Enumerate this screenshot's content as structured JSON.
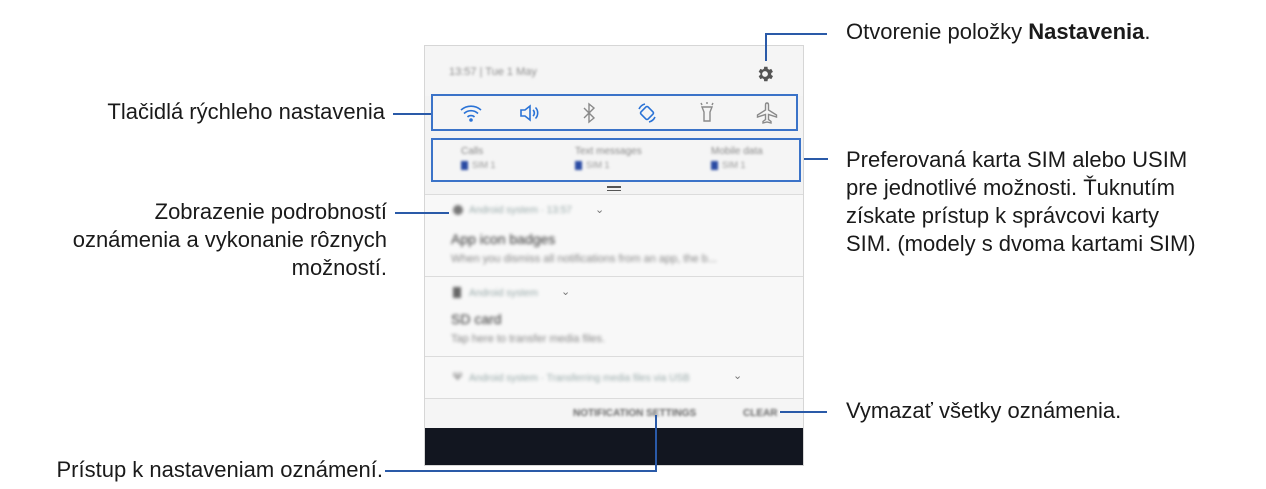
{
  "phone": {
    "status_time": "13:57 | Tue 1 May",
    "sim": [
      {
        "title": "Calls",
        "value": "SIM 1"
      },
      {
        "title": "Text messages",
        "value": "SIM 1"
      },
      {
        "title": "Mobile data",
        "value": "SIM 1"
      }
    ],
    "notifications": [
      {
        "source": "Android system · 13:57",
        "title": "App icon badges",
        "body": "When you dismiss all notifications from an app, the b..."
      },
      {
        "source": "Android system",
        "title": "SD card",
        "body": "Tap here to transfer media files."
      },
      {
        "source": "Android system · Transferring media files via USB"
      }
    ],
    "actions": {
      "settings": "NOTIFICATION SETTINGS",
      "clear": "CLEAR"
    }
  },
  "callouts": {
    "settings_prefix": "Otvorenie položky ",
    "settings_bold": "Nastavenia",
    "settings_suffix": ".",
    "quick": "Tlačidlá rýchleho nastavenia",
    "sim_lines": [
      "Preferovaná karta SIM alebo USIM",
      "pre jednotlivé možnosti. Ťuknutím",
      "získate prístup k správcovi karty",
      "SIM. (modely s dvoma kartami SIM)"
    ],
    "details_lines": [
      "Zobrazenie podrobností",
      "oznámenia a vykonanie rôznych",
      "možností."
    ],
    "clear_all": "Vymazať všetky oznámenia.",
    "notif_settings": "Prístup k nastaveniam oznámení."
  }
}
